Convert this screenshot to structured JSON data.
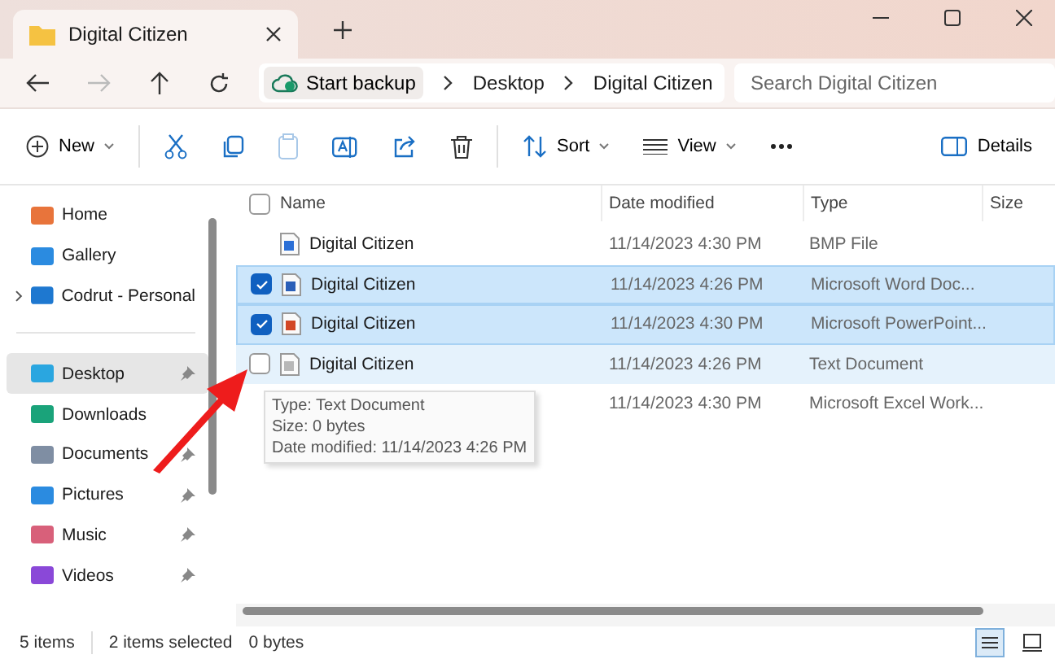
{
  "window": {
    "tab_title": "Digital Citizen"
  },
  "address": {
    "backup": "Start backup",
    "crumbs": [
      "Desktop",
      "Digital Citizen"
    ],
    "search_placeholder": "Search Digital Citizen"
  },
  "toolbar": {
    "new": "New",
    "sort": "Sort",
    "view": "View",
    "details": "Details"
  },
  "sidebar": {
    "items": [
      {
        "label": "Home",
        "kind": "home",
        "selected": false,
        "pinned": false,
        "expandable": false
      },
      {
        "label": "Gallery",
        "kind": "gallery",
        "selected": false,
        "pinned": false,
        "expandable": false
      },
      {
        "label": "Codrut - Personal",
        "kind": "cloud",
        "selected": false,
        "pinned": false,
        "expandable": true
      },
      {
        "label": "Desktop",
        "kind": "desktop",
        "selected": true,
        "pinned": true,
        "expandable": false
      },
      {
        "label": "Downloads",
        "kind": "downloads",
        "selected": false,
        "pinned": false,
        "expandable": false
      },
      {
        "label": "Documents",
        "kind": "documents",
        "selected": false,
        "pinned": true,
        "expandable": false
      },
      {
        "label": "Pictures",
        "kind": "pictures",
        "selected": false,
        "pinned": true,
        "expandable": false
      },
      {
        "label": "Music",
        "kind": "music",
        "selected": false,
        "pinned": true,
        "expandable": false
      },
      {
        "label": "Videos",
        "kind": "videos",
        "selected": false,
        "pinned": true,
        "expandable": false
      }
    ]
  },
  "table": {
    "select_all_checked": false,
    "columns": [
      "Name",
      "Date modified",
      "Type",
      "Size"
    ],
    "rows": [
      {
        "name": "Digital Citizen",
        "kind": "bmp",
        "date": "11/14/2023 4:30 PM",
        "type": "BMP File",
        "selected": false,
        "hovered": false
      },
      {
        "name": "Digital Citizen",
        "kind": "word",
        "date": "11/14/2023 4:26 PM",
        "type": "Microsoft Word Doc...",
        "selected": true,
        "hovered": false
      },
      {
        "name": "Digital Citizen",
        "kind": "powerpoint",
        "date": "11/14/2023 4:30 PM",
        "type": "Microsoft PowerPoint...",
        "selected": true,
        "hovered": false
      },
      {
        "name": "Digital Citizen",
        "kind": "text",
        "date": "11/14/2023 4:26 PM",
        "type": "Text Document",
        "selected": false,
        "hovered": true
      },
      {
        "date": "11/14/2023 4:30 PM",
        "type": "Microsoft Excel Work...",
        "selected": false,
        "hovered": false
      }
    ]
  },
  "tooltip": {
    "lines": [
      "Type: Text Document",
      "Size: 0 bytes",
      "Date modified: 11/14/2023 4:26 PM"
    ]
  },
  "status_bar": {
    "count": "5 items",
    "selection": "2 items selected",
    "size": "0 bytes"
  }
}
